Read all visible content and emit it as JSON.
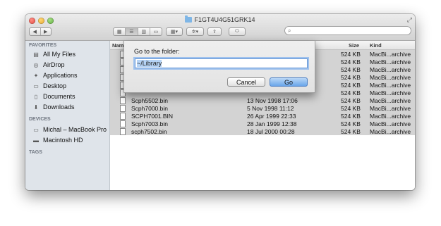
{
  "window": {
    "title": "F1GT4U4G51GRK14"
  },
  "toolbar": {
    "back_icon": "chevron-left-icon",
    "forward_icon": "chevron-right-icon",
    "view_modes": [
      "icon-view",
      "list-view",
      "column-view",
      "coverflow-view"
    ],
    "arrange_icon": "grid-icon",
    "action_icon": "gear-icon",
    "share_icon": "share-icon",
    "tags_icon": "tag-icon",
    "search_placeholder": ""
  },
  "sidebar": {
    "favorites_title": "FAVORITES",
    "favorites": [
      {
        "label": "All My Files",
        "icon": "all-files-icon"
      },
      {
        "label": "AirDrop",
        "icon": "airdrop-icon"
      },
      {
        "label": "Applications",
        "icon": "applications-icon"
      },
      {
        "label": "Desktop",
        "icon": "desktop-icon"
      },
      {
        "label": "Documents",
        "icon": "documents-icon"
      },
      {
        "label": "Downloads",
        "icon": "downloads-icon"
      }
    ],
    "devices_title": "DEVICES",
    "devices": [
      {
        "label": "Michal – MacBook Pro",
        "icon": "laptop-icon"
      },
      {
        "label": "Macintosh HD",
        "icon": "drive-icon"
      }
    ],
    "tags_title": "TAGS"
  },
  "columns": {
    "name": "Name",
    "size": "Size",
    "kind": "Kind"
  },
  "files": [
    {
      "name": "",
      "date": "",
      "size": "524 KB",
      "kind": "MacBi...archive"
    },
    {
      "name": "",
      "date": "",
      "size": "524 KB",
      "kind": "MacBi...archive"
    },
    {
      "name": "",
      "date": "",
      "size": "524 KB",
      "kind": "MacBi...archive"
    },
    {
      "name": "",
      "date": "",
      "size": "524 KB",
      "kind": "MacBi...archive"
    },
    {
      "name": "",
      "date": "",
      "size": "524 KB",
      "kind": "MacBi...archive"
    },
    {
      "name": "",
      "date": "",
      "size": "524 KB",
      "kind": "MacBi...archive"
    },
    {
      "name": "Scph5502.bin",
      "date": "13 Nov 1998 17:06",
      "size": "524 KB",
      "kind": "MacBi...archive"
    },
    {
      "name": "Scph7000.bin",
      "date": "5 Nov 1998 11:12",
      "size": "524 KB",
      "kind": "MacBi...archive"
    },
    {
      "name": "SCPH7001.BIN",
      "date": "26 Apr 1999 22:33",
      "size": "524 KB",
      "kind": "MacBi...archive"
    },
    {
      "name": "Scph7003.bin",
      "date": "28 Jan 1999 12:38",
      "size": "524 KB",
      "kind": "MacBi...archive"
    },
    {
      "name": "scph7502.bin",
      "date": "18 Jul 2000 00:28",
      "size": "524 KB",
      "kind": "MacBi...archive"
    }
  ],
  "dialog": {
    "label": "Go to the folder:",
    "value": "~/Library",
    "cancel": "Cancel",
    "go": "Go"
  }
}
